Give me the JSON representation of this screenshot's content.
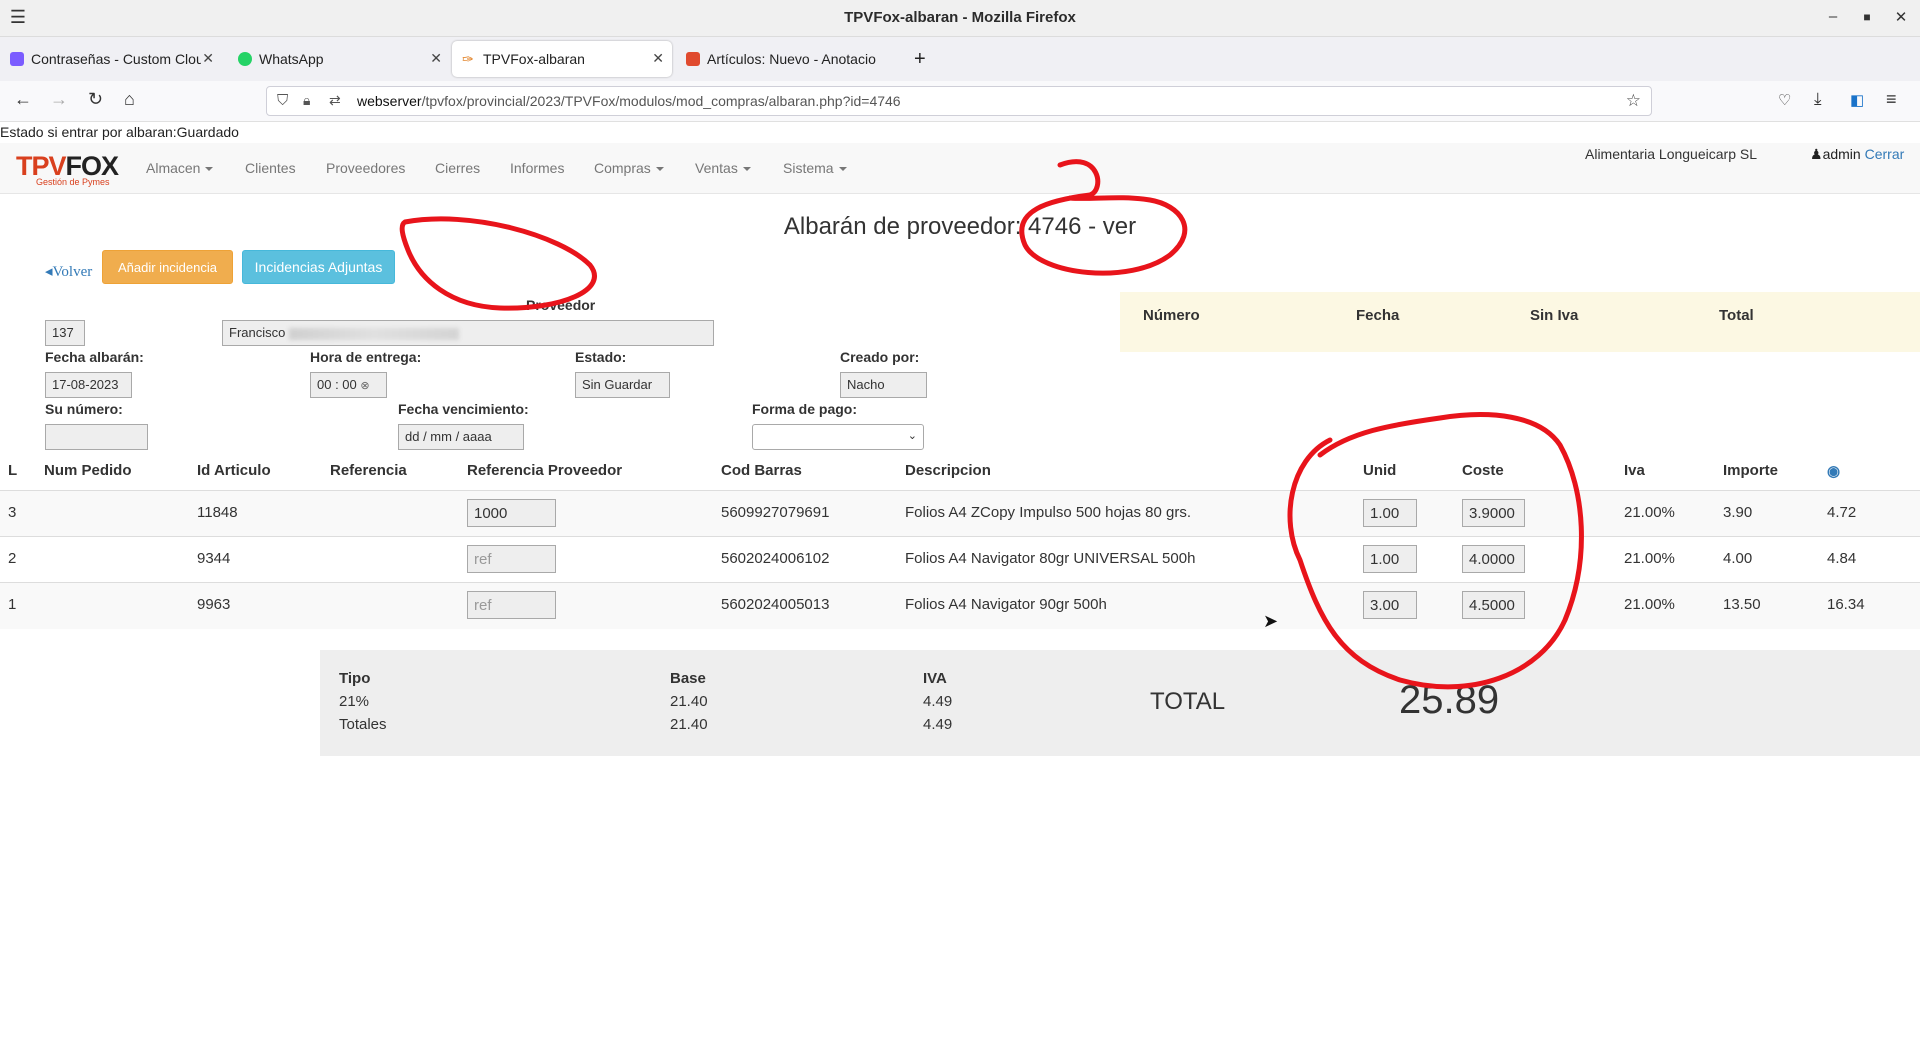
{
  "window": {
    "title": "TPVFox-albaran - Mozilla Firefox"
  },
  "tabs": [
    {
      "label": "Contraseñas - Custom Clou",
      "color": "#7b5cff"
    },
    {
      "label": "WhatsApp",
      "color": "#25d366"
    },
    {
      "label": "TPVFox-albaran",
      "color": "#e07b1a"
    },
    {
      "label": "Artículos: Nuevo - Anotacio",
      "color": "#e04a2e"
    }
  ],
  "url": {
    "host": "webserver",
    "path": "/tpvfox/provincial/2023/TPVFox/modulos/mod_compras/albaran.php?id=4746"
  },
  "status_line": "Estado si entrar por albaran:Guardado",
  "appnav": {
    "logo_main": "TPVFOX",
    "logo_t": "TPV",
    "logo_f": "FOX",
    "logo_sub": "Gestión de Pymes",
    "menu": [
      "Almacen",
      "Clientes",
      "Proveedores",
      "Cierres",
      "Informes",
      "Compras",
      "Ventas",
      "Sistema"
    ],
    "company": "Alimentaria Longueicarp SL",
    "user": "admin",
    "logout": "Cerrar"
  },
  "page": {
    "title": "Albarán de proveedor: 4746 - ver",
    "back": "Volver",
    "add_incident": "Añadir incidencia",
    "attached_incidents": "Incidencias Adjuntas"
  },
  "form": {
    "proveedor_label": "Proveedor",
    "proveedor_id": "137",
    "proveedor_name": "Francisco",
    "fecha_label": "Fecha albarán:",
    "fecha_value": "17-08-2023",
    "hora_label": "Hora de entrega:",
    "hora_value": "00 : 00",
    "estado_label": "Estado:",
    "estado_value": "Sin Guardar",
    "creado_label": "Creado por:",
    "creado_value": "Nacho",
    "su_numero_label": "Su número:",
    "su_numero_value": "",
    "vencimiento_label": "Fecha vencimiento:",
    "vencimiento_value": "dd / mm / aaaa",
    "forma_pago_label": "Forma de pago:",
    "forma_pago_value": ""
  },
  "summary": {
    "headers": [
      "Número",
      "Fecha",
      "Sin Iva",
      "Total"
    ]
  },
  "table": {
    "headers": [
      "L",
      "Num Pedido",
      "Id Articulo",
      "Referencia",
      "Referencia Proveedor",
      "Cod Barras",
      "Descripcion",
      "Unid",
      "Coste",
      "Iva",
      "Importe"
    ],
    "rows": [
      {
        "l": "3",
        "num_pedido": "",
        "id": "11848",
        "ref": "",
        "ref_prov": "1000",
        "ref_prov_placeholder": false,
        "barcode": "5609927079691",
        "desc": "Folios A4 ZCopy Impulso 500 hojas 80 grs.",
        "unid": "1.00",
        "coste": "3.9000",
        "iva": "21.00%",
        "importe": "3.90",
        "total": "4.72"
      },
      {
        "l": "2",
        "num_pedido": "",
        "id": "9344",
        "ref": "",
        "ref_prov": "ref",
        "ref_prov_placeholder": true,
        "barcode": "5602024006102",
        "desc": "Folios A4 Navigator 80gr UNIVERSAL 500h",
        "unid": "1.00",
        "coste": "4.0000",
        "iva": "21.00%",
        "importe": "4.00",
        "total": "4.84"
      },
      {
        "l": "1",
        "num_pedido": "",
        "id": "9963",
        "ref": "",
        "ref_prov": "ref",
        "ref_prov_placeholder": true,
        "barcode": "5602024005013",
        "desc": "Folios A4 Navigator 90gr 500h",
        "unid": "3.00",
        "coste": "4.5000",
        "iva": "21.00%",
        "importe": "13.50",
        "total": "16.34"
      }
    ]
  },
  "totals": {
    "headers": [
      "Tipo",
      "Base",
      "IVA"
    ],
    "rows": [
      {
        "tipo": "21%",
        "base": "21.40",
        "iva": "4.49"
      },
      {
        "tipo": "Totales",
        "base": "21.40",
        "iva": "4.49"
      }
    ],
    "total_label": "TOTAL",
    "total_value": "25.89"
  },
  "colors": {
    "accent": "#337ab7",
    "warning": "#f0ad4e",
    "info": "#5bc0de",
    "annotation": "#e8141b"
  }
}
